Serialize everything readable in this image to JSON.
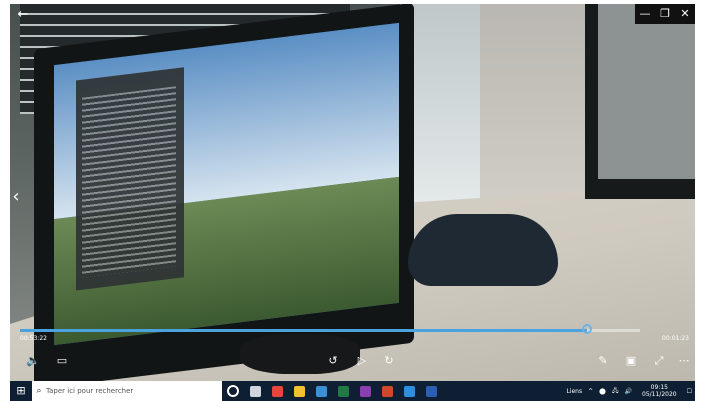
{
  "player": {
    "back_icon": "back-arrow-icon",
    "window_controls": [
      "—",
      "❐",
      "✕"
    ],
    "prev_icon": "chevron-left-icon",
    "time_elapsed": "00:53:22",
    "time_remaining": "00:01:23",
    "progress_fraction": 0.915,
    "accent_color": "#4aa3df"
  },
  "controls": {
    "volume_icon": "volume-icon",
    "subtitles_icon": "subtitles-icon",
    "rewind_icon": "rewind-10-icon",
    "play_icon": "play-icon",
    "forward_icon": "forward-30-icon",
    "edit_icon": "pencil-icon",
    "miniview_icon": "mini-view-icon",
    "fullscreen_icon": "fullscreen-icon",
    "more_icon": "more-icon"
  },
  "taskbar": {
    "search_placeholder": "Taper ici pour rechercher",
    "apps": [
      {
        "name": "cortana-icon",
        "color": "#ffffff"
      },
      {
        "name": "task-view-icon",
        "color": "#cfd6de"
      },
      {
        "name": "chrome-icon",
        "color": "#e8453c"
      },
      {
        "name": "file-explorer-icon",
        "color": "#f2c230"
      },
      {
        "name": "edge-icon",
        "color": "#3a8fd6"
      },
      {
        "name": "excel-icon",
        "color": "#1f7a44"
      },
      {
        "name": "onenote-icon",
        "color": "#8a3fb0"
      },
      {
        "name": "powerpoint-icon",
        "color": "#d0482b"
      },
      {
        "name": "photos-icon",
        "color": "#2e8fe0"
      },
      {
        "name": "word-icon",
        "color": "#2b5fb4"
      }
    ],
    "tray_items": [
      "Liens",
      "^",
      "⬤",
      "🖧",
      "🔊",
      "☐"
    ],
    "time": "09:15",
    "date": "05/11/2020"
  }
}
